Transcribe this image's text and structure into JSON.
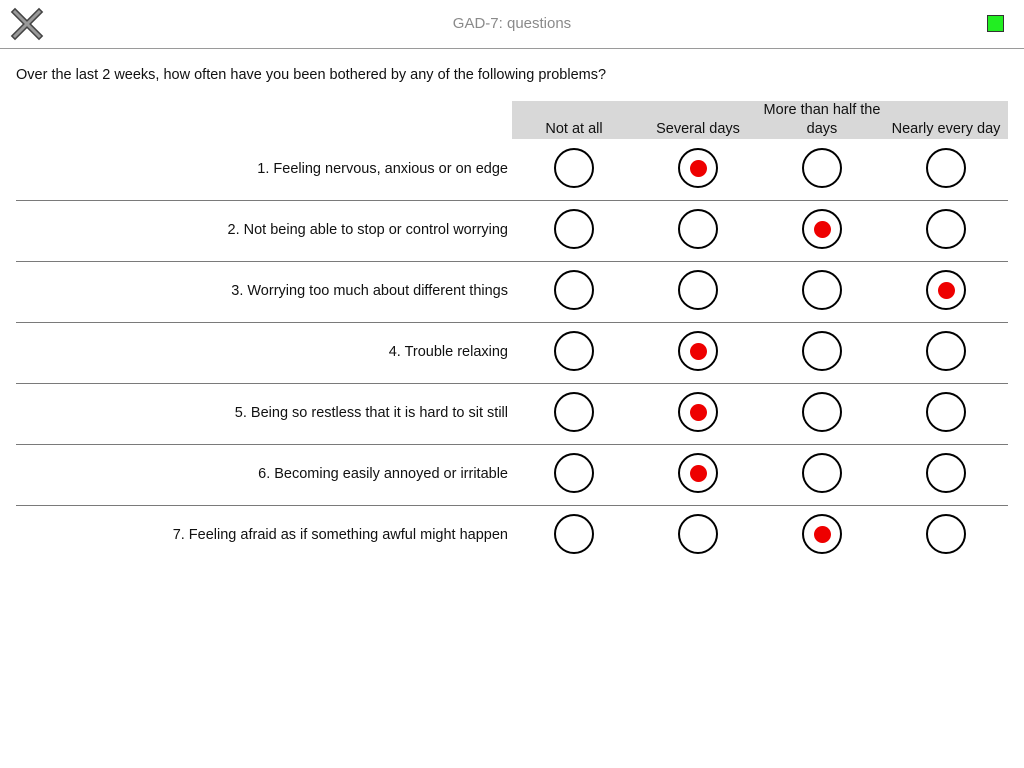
{
  "header": {
    "title": "GAD-7: questions",
    "close_icon": "close-x-icon",
    "status_color": "#22ee22"
  },
  "question": "Over the last 2 weeks, how often have you been bothered by any of the following problems?",
  "columns": [
    "Not at all",
    "Several days",
    "More than half the days",
    "Nearly every day"
  ],
  "items": [
    {
      "label": "1. Feeling nervous, anxious or on edge",
      "selected": 1
    },
    {
      "label": "2. Not being able to stop or control worrying",
      "selected": 2
    },
    {
      "label": "3. Worrying too much about different things",
      "selected": 3
    },
    {
      "label": "4. Trouble relaxing",
      "selected": 1
    },
    {
      "label": "5. Being so restless that it is hard to sit still",
      "selected": 1
    },
    {
      "label": "6. Becoming easily annoyed or irritable",
      "selected": 1
    },
    {
      "label": "7. Feeling afraid as if something awful might happen",
      "selected": 2
    }
  ],
  "colors": {
    "selected_dot": "#ee0000",
    "header_band": "#d8d8d8"
  }
}
